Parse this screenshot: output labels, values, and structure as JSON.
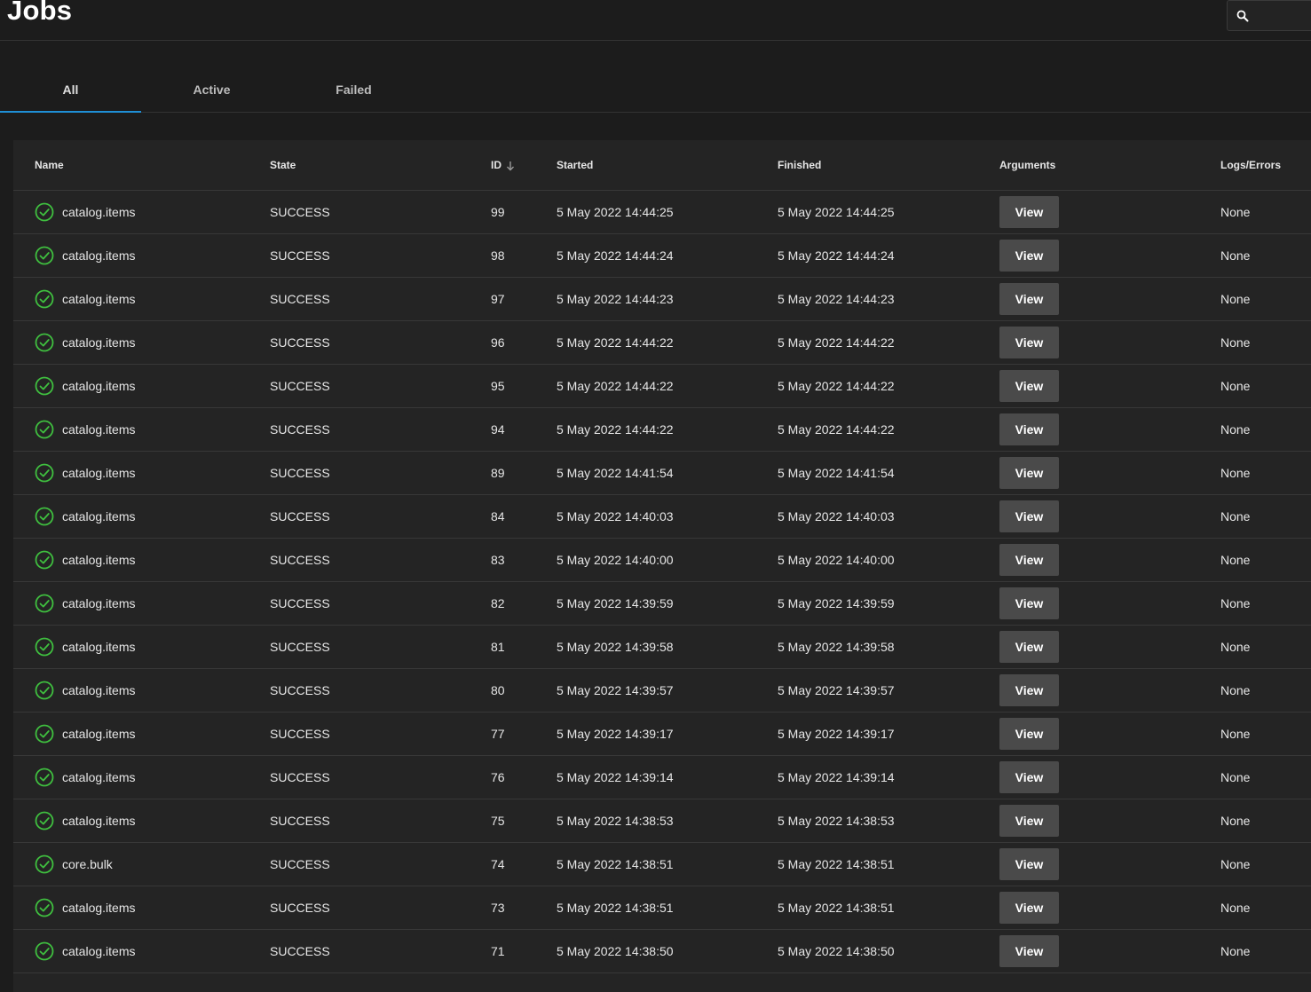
{
  "header": {
    "title": "Jobs",
    "search_placeholder": ""
  },
  "tabs": [
    {
      "label": "All",
      "active": true
    },
    {
      "label": "Active",
      "active": false
    },
    {
      "label": "Failed",
      "active": false
    }
  ],
  "table": {
    "columns": {
      "name": "Name",
      "state": "State",
      "id": "ID",
      "started": "Started",
      "finished": "Finished",
      "arguments": "Arguments",
      "logs": "Logs/Errors"
    },
    "sort": {
      "column": "id",
      "direction": "descending"
    },
    "view_label": "View",
    "rows": [
      {
        "name": "catalog.items",
        "state": "SUCCESS",
        "id": "99",
        "started": "5 May 2022 14:44:25",
        "finished": "5 May 2022 14:44:25",
        "logs": "None"
      },
      {
        "name": "catalog.items",
        "state": "SUCCESS",
        "id": "98",
        "started": "5 May 2022 14:44:24",
        "finished": "5 May 2022 14:44:24",
        "logs": "None"
      },
      {
        "name": "catalog.items",
        "state": "SUCCESS",
        "id": "97",
        "started": "5 May 2022 14:44:23",
        "finished": "5 May 2022 14:44:23",
        "logs": "None"
      },
      {
        "name": "catalog.items",
        "state": "SUCCESS",
        "id": "96",
        "started": "5 May 2022 14:44:22",
        "finished": "5 May 2022 14:44:22",
        "logs": "None"
      },
      {
        "name": "catalog.items",
        "state": "SUCCESS",
        "id": "95",
        "started": "5 May 2022 14:44:22",
        "finished": "5 May 2022 14:44:22",
        "logs": "None"
      },
      {
        "name": "catalog.items",
        "state": "SUCCESS",
        "id": "94",
        "started": "5 May 2022 14:44:22",
        "finished": "5 May 2022 14:44:22",
        "logs": "None"
      },
      {
        "name": "catalog.items",
        "state": "SUCCESS",
        "id": "89",
        "started": "5 May 2022 14:41:54",
        "finished": "5 May 2022 14:41:54",
        "logs": "None"
      },
      {
        "name": "catalog.items",
        "state": "SUCCESS",
        "id": "84",
        "started": "5 May 2022 14:40:03",
        "finished": "5 May 2022 14:40:03",
        "logs": "None"
      },
      {
        "name": "catalog.items",
        "state": "SUCCESS",
        "id": "83",
        "started": "5 May 2022 14:40:00",
        "finished": "5 May 2022 14:40:00",
        "logs": "None"
      },
      {
        "name": "catalog.items",
        "state": "SUCCESS",
        "id": "82",
        "started": "5 May 2022 14:39:59",
        "finished": "5 May 2022 14:39:59",
        "logs": "None"
      },
      {
        "name": "catalog.items",
        "state": "SUCCESS",
        "id": "81",
        "started": "5 May 2022 14:39:58",
        "finished": "5 May 2022 14:39:58",
        "logs": "None"
      },
      {
        "name": "catalog.items",
        "state": "SUCCESS",
        "id": "80",
        "started": "5 May 2022 14:39:57",
        "finished": "5 May 2022 14:39:57",
        "logs": "None"
      },
      {
        "name": "catalog.items",
        "state": "SUCCESS",
        "id": "77",
        "started": "5 May 2022 14:39:17",
        "finished": "5 May 2022 14:39:17",
        "logs": "None"
      },
      {
        "name": "catalog.items",
        "state": "SUCCESS",
        "id": "76",
        "started": "5 May 2022 14:39:14",
        "finished": "5 May 2022 14:39:14",
        "logs": "None"
      },
      {
        "name": "catalog.items",
        "state": "SUCCESS",
        "id": "75",
        "started": "5 May 2022 14:38:53",
        "finished": "5 May 2022 14:38:53",
        "logs": "None"
      },
      {
        "name": "core.bulk",
        "state": "SUCCESS",
        "id": "74",
        "started": "5 May 2022 14:38:51",
        "finished": "5 May 2022 14:38:51",
        "logs": "None"
      },
      {
        "name": "catalog.items",
        "state": "SUCCESS",
        "id": "73",
        "started": "5 May 2022 14:38:51",
        "finished": "5 May 2022 14:38:51",
        "logs": "None"
      },
      {
        "name": "catalog.items",
        "state": "SUCCESS",
        "id": "71",
        "started": "5 May 2022 14:38:50",
        "finished": "5 May 2022 14:38:50",
        "logs": "None"
      }
    ]
  },
  "colors": {
    "background": "#1c1c1c",
    "table_background": "#242424",
    "accent": "#1f8fd6",
    "success": "#3fbf3f",
    "button": "#4a4a4a"
  },
  "icons": {
    "search": "search-icon",
    "success": "check-circle-icon",
    "sort": "arrow-down-icon"
  }
}
